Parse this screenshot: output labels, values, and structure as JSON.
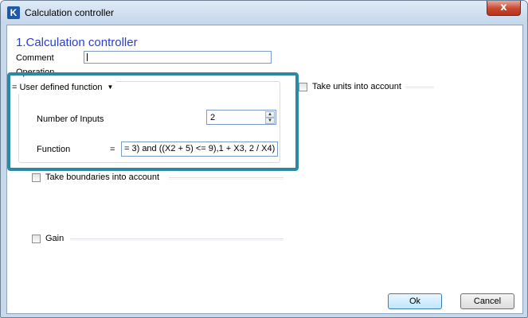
{
  "window": {
    "title": "Calculation controller",
    "app_icon_letter": "K",
    "close_symbol": "x",
    "icon": "k-app-icon"
  },
  "heading": "1.Calculation controller",
  "comment": {
    "label": "Comment",
    "value": ""
  },
  "operation": {
    "label": "Operation",
    "selected": "= User defined function",
    "number_of_inputs_label": "Number of Inputs",
    "number_of_inputs_value": "2",
    "function_label": "Function",
    "equals": "=",
    "function_value": "= 3) and ((X2 + 5) <= 9),1 + X3, 2 / X4)"
  },
  "options": {
    "take_units": "Take units into account",
    "take_boundaries": "Take boundaries into account",
    "gain": "Gain"
  },
  "buttons": {
    "ok": "Ok",
    "cancel": "Cancel"
  },
  "colors": {
    "heading": "#2a3fcf",
    "highlight_frame": "#2b8aa3",
    "close_button": "#c7472f"
  }
}
